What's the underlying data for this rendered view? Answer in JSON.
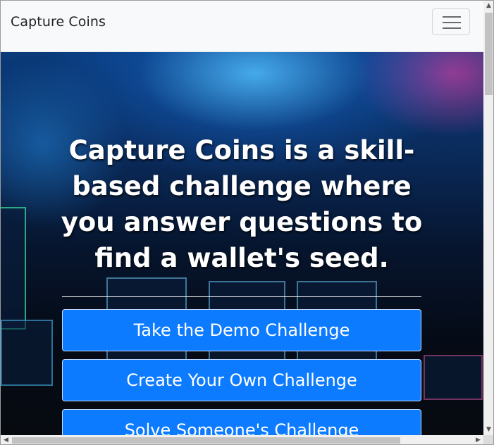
{
  "navbar": {
    "brand": "Capture Coins",
    "toggler_icon": "hamburger-menu-icon"
  },
  "hero": {
    "heading": "Capture Coins is a skill-based challenge where you answer questions to find a wallet's seed.",
    "buttons": [
      {
        "label": "Take the Demo Challenge"
      },
      {
        "label": "Create Your Own Challenge"
      },
      {
        "label": "Solve Someone's Challenge"
      }
    ]
  },
  "colors": {
    "button": "#0d7bff",
    "navbar_bg": "#f8f9fa",
    "heading_text": "#ffffff"
  }
}
